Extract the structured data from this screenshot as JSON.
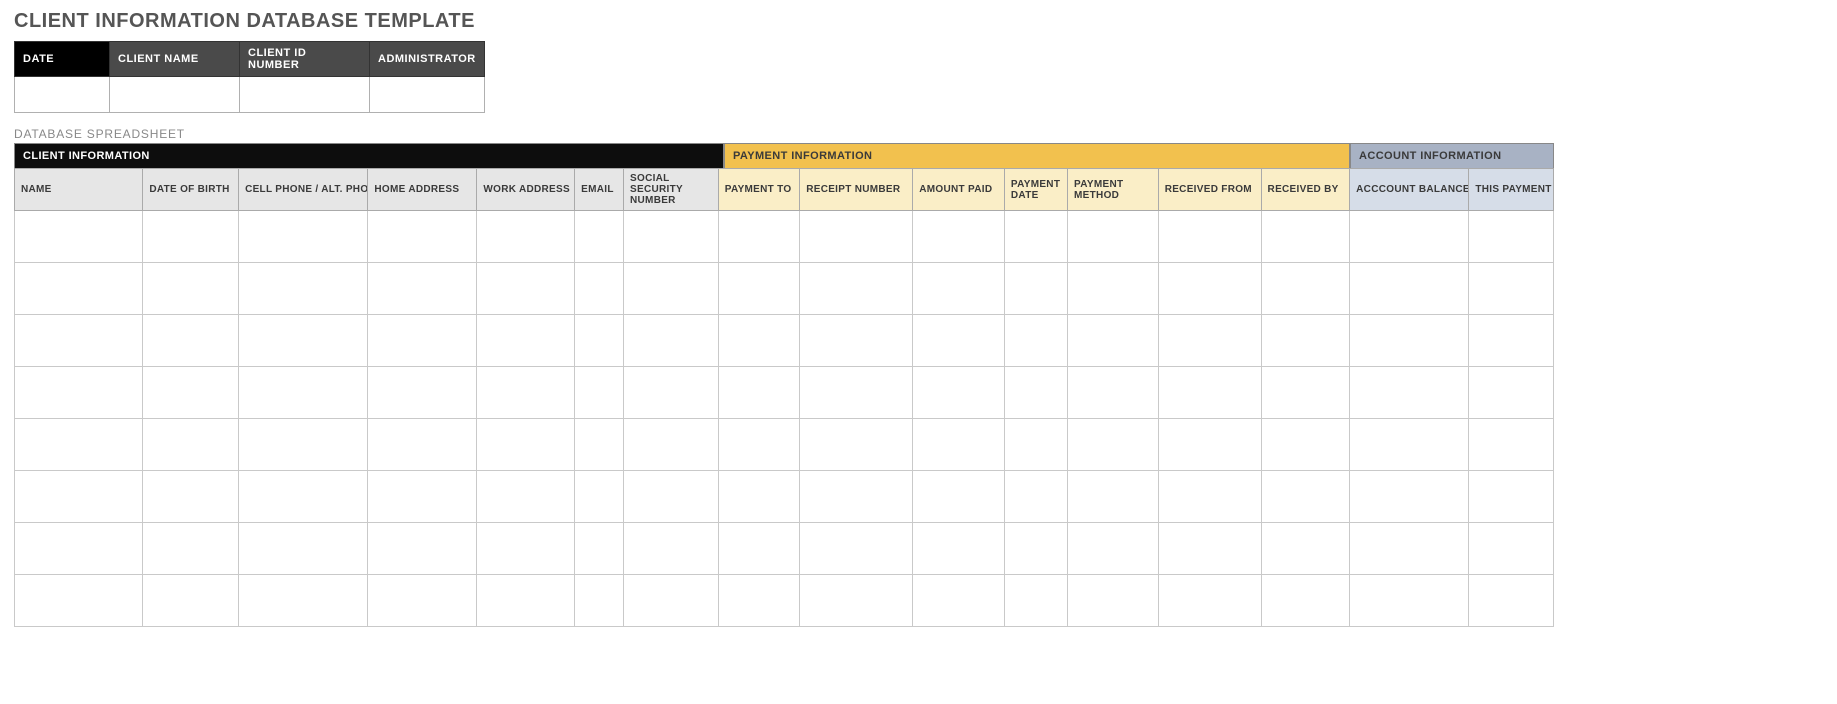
{
  "title": "CLIENT INFORMATION DATABASE TEMPLATE",
  "meta": {
    "headers": {
      "date": "DATE",
      "client_name": "CLIENT NAME",
      "client_id": "CLIENT ID NUMBER",
      "administrator": "ADMINISTRATOR"
    },
    "values": {
      "date": "",
      "client_name": "",
      "client_id": "",
      "administrator": ""
    }
  },
  "section_label": "DATABASE SPREADSHEET",
  "group_headers": {
    "client": "CLIENT INFORMATION",
    "payment": "PAYMENT INFORMATION",
    "account": "ACCOUNT INFORMATION"
  },
  "columns": {
    "client": {
      "name": "NAME",
      "dob": "DATE OF BIRTH",
      "phone": "CELL PHONE / ALT. PHONE",
      "home_address": "HOME ADDRESS",
      "work_address": "WORK ADDRESS",
      "email": "EMAIL",
      "ssn": "SOCIAL SECURITY NUMBER"
    },
    "payment": {
      "payment_to": "PAYMENT TO",
      "receipt_number": "RECEIPT NUMBER",
      "amount_paid": "AMOUNT PAID",
      "payment_date": "PAYMENT DATE",
      "payment_method": "PAYMENT METHOD",
      "received_from": "RECEIVED FROM",
      "received_by": "RECEIVED BY"
    },
    "account": {
      "balance": "ACCCOUNT BALANCE",
      "this_payment": "THIS PAYMENT"
    }
  },
  "rows": [
    {
      "name": "",
      "dob": "",
      "phone": "",
      "home_address": "",
      "work_address": "",
      "email": "",
      "ssn": "",
      "payment_to": "",
      "receipt_number": "",
      "amount_paid": "",
      "payment_date": "",
      "payment_method": "",
      "received_from": "",
      "received_by": "",
      "balance": "",
      "this_payment": ""
    },
    {
      "name": "",
      "dob": "",
      "phone": "",
      "home_address": "",
      "work_address": "",
      "email": "",
      "ssn": "",
      "payment_to": "",
      "receipt_number": "",
      "amount_paid": "",
      "payment_date": "",
      "payment_method": "",
      "received_from": "",
      "received_by": "",
      "balance": "",
      "this_payment": ""
    },
    {
      "name": "",
      "dob": "",
      "phone": "",
      "home_address": "",
      "work_address": "",
      "email": "",
      "ssn": "",
      "payment_to": "",
      "receipt_number": "",
      "amount_paid": "",
      "payment_date": "",
      "payment_method": "",
      "received_from": "",
      "received_by": "",
      "balance": "",
      "this_payment": ""
    },
    {
      "name": "",
      "dob": "",
      "phone": "",
      "home_address": "",
      "work_address": "",
      "email": "",
      "ssn": "",
      "payment_to": "",
      "receipt_number": "",
      "amount_paid": "",
      "payment_date": "",
      "payment_method": "",
      "received_from": "",
      "received_by": "",
      "balance": "",
      "this_payment": ""
    },
    {
      "name": "",
      "dob": "",
      "phone": "",
      "home_address": "",
      "work_address": "",
      "email": "",
      "ssn": "",
      "payment_to": "",
      "receipt_number": "",
      "amount_paid": "",
      "payment_date": "",
      "payment_method": "",
      "received_from": "",
      "received_by": "",
      "balance": "",
      "this_payment": ""
    },
    {
      "name": "",
      "dob": "",
      "phone": "",
      "home_address": "",
      "work_address": "",
      "email": "",
      "ssn": "",
      "payment_to": "",
      "receipt_number": "",
      "amount_paid": "",
      "payment_date": "",
      "payment_method": "",
      "received_from": "",
      "received_by": "",
      "balance": "",
      "this_payment": ""
    },
    {
      "name": "",
      "dob": "",
      "phone": "",
      "home_address": "",
      "work_address": "",
      "email": "",
      "ssn": "",
      "payment_to": "",
      "receipt_number": "",
      "amount_paid": "",
      "payment_date": "",
      "payment_method": "",
      "received_from": "",
      "received_by": "",
      "balance": "",
      "this_payment": ""
    },
    {
      "name": "",
      "dob": "",
      "phone": "",
      "home_address": "",
      "work_address": "",
      "email": "",
      "ssn": "",
      "payment_to": "",
      "receipt_number": "",
      "amount_paid": "",
      "payment_date": "",
      "payment_method": "",
      "received_from": "",
      "received_by": "",
      "balance": "",
      "this_payment": ""
    }
  ]
}
